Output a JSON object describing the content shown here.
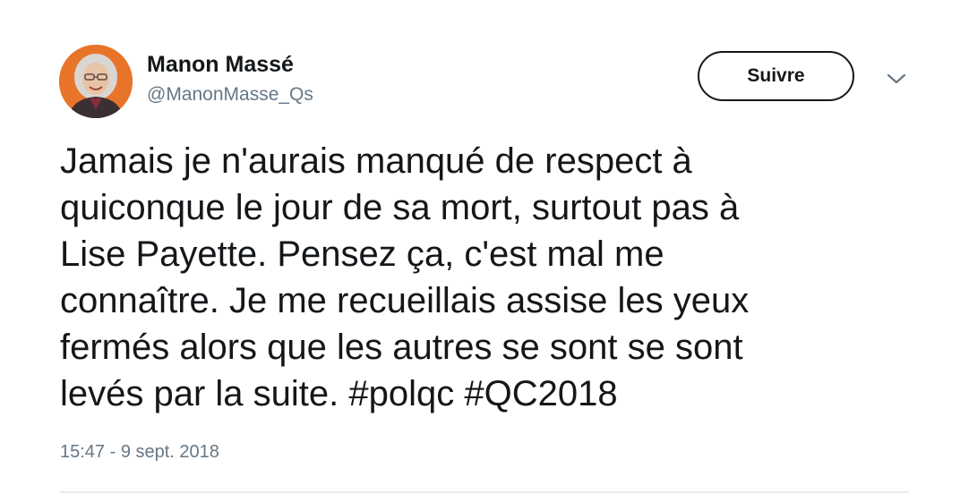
{
  "author": {
    "display_name": "Manon Massé",
    "handle": "@ManonMasse_Qs"
  },
  "follow_button": {
    "label": "Suivre"
  },
  "tweet": {
    "text": "Jamais je n'aurais manqué de respect à\nquiconque le jour de sa mort, surtout pas à\nLise Payette. Pensez ça, c'est mal me\nconnaître. Je me recueillais assise les yeux\nfermés alors que les autres se sont se sont\nlevés par la suite. #polqc #QC2018",
    "timestamp": "15:47 - 9 sept. 2018"
  },
  "icons": {
    "menu": "chevron-down-icon",
    "avatar": "avatar"
  },
  "colors": {
    "text": "#14171a",
    "secondary": "#657786",
    "divider": "#e6ecf0",
    "avatar_background": "#e8742a"
  }
}
